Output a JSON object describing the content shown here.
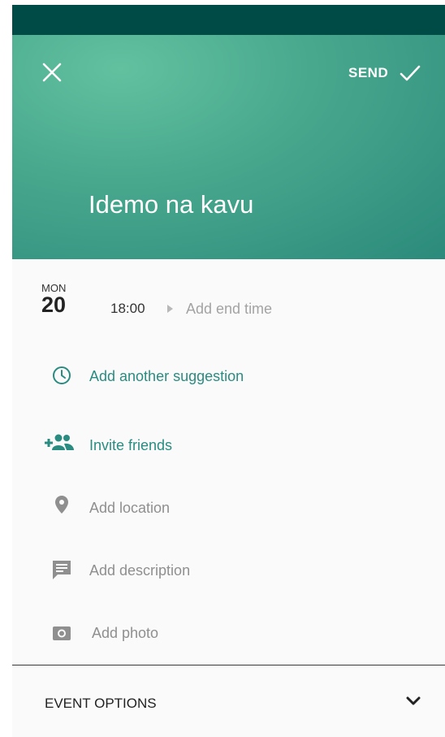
{
  "header": {
    "send_label": "SEND",
    "title": "Idemo na kavu"
  },
  "date": {
    "day_of_week": "MON",
    "day_number": "20",
    "start_time": "18:00",
    "end_time_placeholder": "Add end time"
  },
  "items": {
    "suggestion": "Add another suggestion",
    "invite": "Invite friends",
    "location": "Add location",
    "description": "Add description",
    "photo": "Add photo"
  },
  "options": {
    "label": "EVENT OPTIONS"
  },
  "colors": {
    "status_bar": "#004b45",
    "header": "#49a98e",
    "accent": "#2a8c81",
    "muted": "#8f8f8f"
  },
  "icons": [
    "close-icon",
    "check-icon",
    "clock-icon",
    "add-people-icon",
    "location-pin-icon",
    "comment-icon",
    "camera-icon",
    "chevron-down-icon"
  ]
}
